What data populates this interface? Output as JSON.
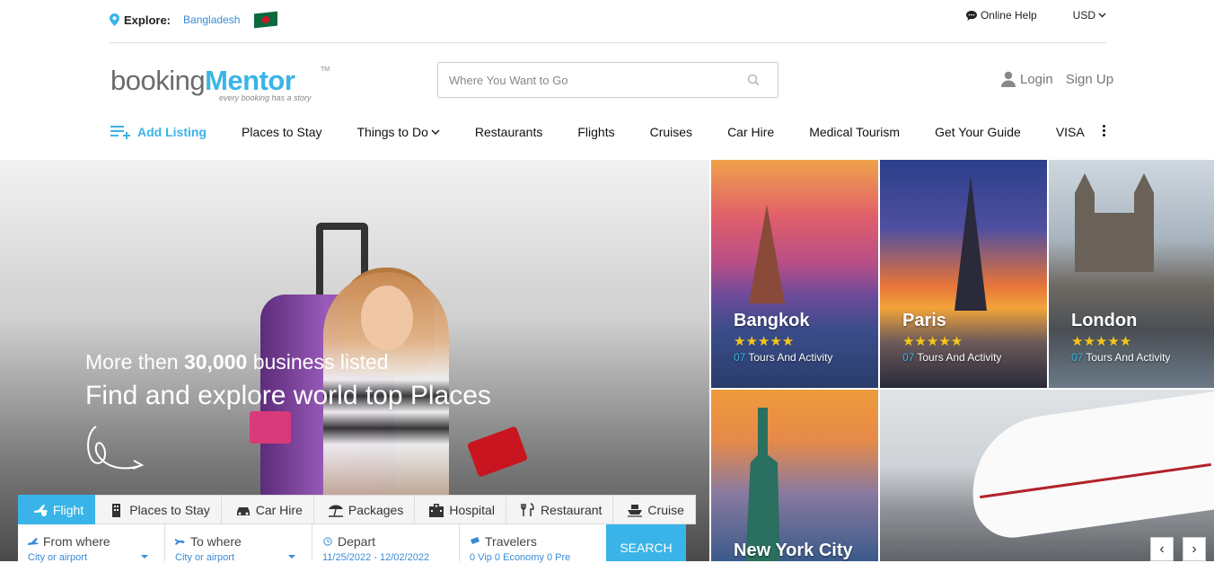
{
  "topbar": {
    "explore_label": "Explore:",
    "country": "Bangladesh",
    "online_help": "Online Help",
    "currency": "USD"
  },
  "header": {
    "logo_part1": "booking",
    "logo_part2": "Mentor",
    "logo_tm": "TM",
    "logo_tagline": "every booking has a story",
    "search_placeholder": "Where You Want to Go",
    "login": "Login",
    "signup": "Sign Up"
  },
  "nav": {
    "add_listing": "Add Listing",
    "items": [
      "Places to Stay",
      "Things to Do",
      "Restaurants",
      "Flights",
      "Cruises",
      "Car Hire",
      "Medical Tourism",
      "Get Your Guide",
      "VISA"
    ]
  },
  "hero": {
    "line1_prefix": "More then ",
    "line1_bold": "30,000",
    "line1_suffix": " business listed",
    "line2": "Find and explore world top Places"
  },
  "search_tabs": [
    "Flight",
    "Places to Stay",
    "Car Hire",
    "Packages",
    "Hospital",
    "Restaurant",
    "Cruise"
  ],
  "search_form": {
    "from_label": "From where",
    "from_value": "City or airport",
    "to_label": "To where",
    "to_value": "City or airport",
    "depart_label": "Depart",
    "depart_value": "11/25/2022 - 12/02/2022",
    "travelers_label": "Travelers",
    "travelers_value": "0 Vip 0 Economy 0 Pre",
    "search_button": "SEARCH"
  },
  "destinations": [
    {
      "name": "Bangkok",
      "stars": "★★★★★",
      "tour_count": "07",
      "tour_label": "Tours And Activity"
    },
    {
      "name": "Paris",
      "stars": "★★★★★",
      "tour_count": "07",
      "tour_label": "Tours And Activity"
    },
    {
      "name": "London",
      "stars": "★★★★★",
      "tour_count": "07",
      "tour_label": "Tours And Activity"
    },
    {
      "name": "New York City"
    }
  ],
  "slider": {
    "prev": "‹",
    "next": "›"
  },
  "colors": {
    "accent": "#3ab4e8",
    "link": "#3a8bd6",
    "star": "#f5c518"
  }
}
